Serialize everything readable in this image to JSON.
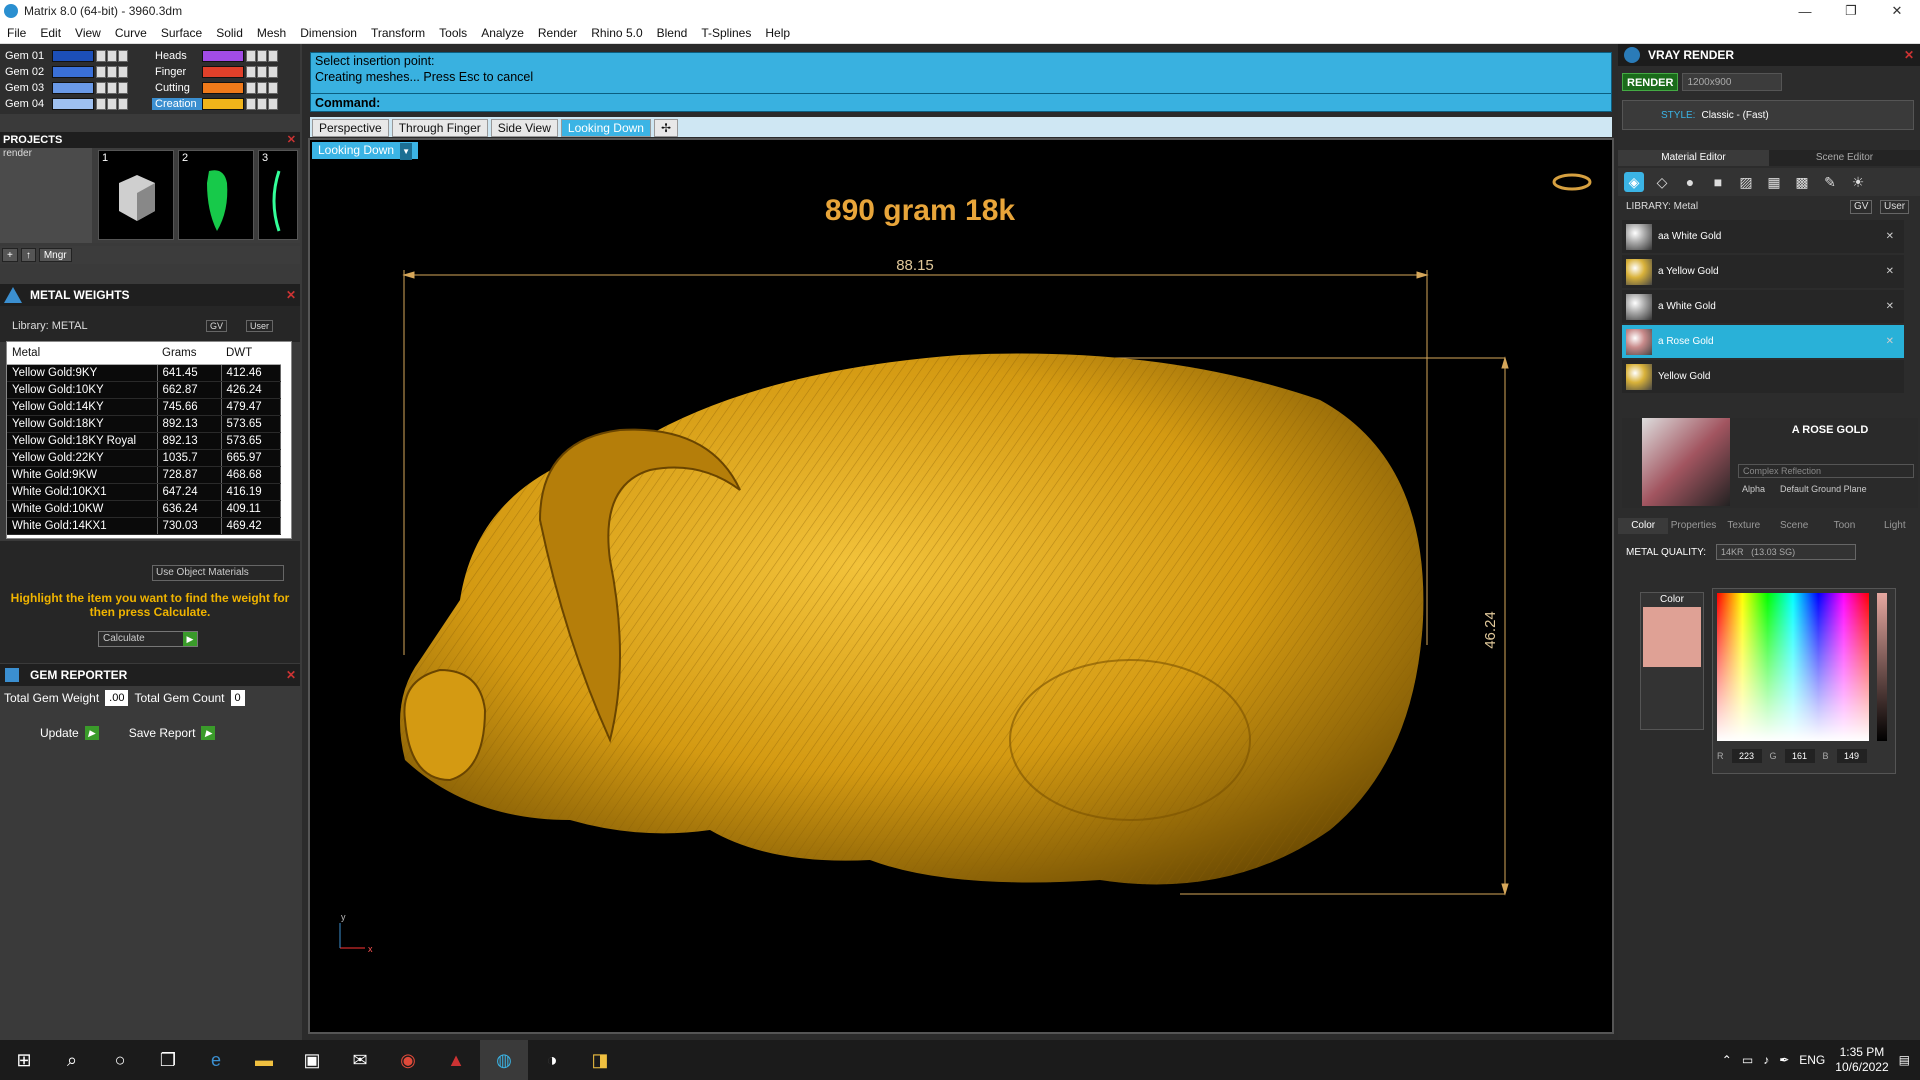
{
  "window": {
    "title": "Matrix 8.0 (64-bit) - 3960.3dm",
    "controls": [
      "—",
      "❐",
      "✕"
    ]
  },
  "menu": [
    "File",
    "Edit",
    "View",
    "Curve",
    "Surface",
    "Solid",
    "Mesh",
    "Dimension",
    "Transform",
    "Tools",
    "Analyze",
    "Render",
    "Rhino 5.0",
    "Blend",
    "T-Splines",
    "Help"
  ],
  "layers": {
    "left": [
      {
        "name": "Gem 01",
        "color": "#1c4fb8"
      },
      {
        "name": "Gem 02",
        "color": "#3a70d8"
      },
      {
        "name": "Gem 03",
        "color": "#6a9ae8"
      },
      {
        "name": "Gem 04",
        "color": "#9ec0f0"
      }
    ],
    "right": [
      {
        "name": "Heads",
        "color": "#a24ce6"
      },
      {
        "name": "Finger",
        "color": "#e0402a"
      },
      {
        "name": "Cutting",
        "color": "#f07a1a"
      },
      {
        "name": "Creation",
        "color": "#f0b41a"
      }
    ]
  },
  "projects": {
    "title": "PROJECTS",
    "list_item": "render",
    "thumb_numbers": [
      "1",
      "2",
      "3"
    ],
    "toolbar": [
      "+",
      "↑",
      "Mngr"
    ]
  },
  "metal_weights": {
    "title": "METAL WEIGHTS",
    "library": "Library: METAL",
    "gv": "GV",
    "user": "User",
    "columns": [
      "Metal",
      "Grams",
      "DWT"
    ],
    "rows": [
      [
        "Yellow Gold:9KY",
        "641.45",
        "412.46"
      ],
      [
        "Yellow Gold:10KY",
        "662.87",
        "426.24"
      ],
      [
        "Yellow Gold:14KY",
        "745.66",
        "479.47"
      ],
      [
        "Yellow Gold:18KY",
        "892.13",
        "573.65"
      ],
      [
        "Yellow Gold:18KY Royal",
        "892.13",
        "573.65"
      ],
      [
        "Yellow Gold:22KY",
        "1035.7",
        "665.97"
      ],
      [
        "White Gold:9KW",
        "728.87",
        "468.68"
      ],
      [
        "White Gold:10KX1",
        "647.24",
        "416.19"
      ],
      [
        "White Gold:10KW",
        "636.24",
        "409.11"
      ],
      [
        "White Gold:14KX1",
        "730.03",
        "469.42"
      ]
    ],
    "use_object": "Use Object Materials",
    "hint": "Highlight the item you want to find the weight for then press Calculate.",
    "calculate": "Calculate"
  },
  "gem_reporter": {
    "title": "GEM REPORTER",
    "total_weight_label": "Total Gem Weight",
    "total_weight": ".00",
    "total_count_label": "Total Gem Count",
    "total_count": "0",
    "update": "Update",
    "save_report": "Save Report"
  },
  "command": {
    "line1": "Select insertion point:",
    "line2": "Creating meshes... Press Esc to cancel",
    "prompt": "Command:"
  },
  "view_tabs": [
    "Perspective",
    "Through Finger",
    "Side View",
    "Looking Down"
  ],
  "active_view": "Looking Down",
  "viewport": {
    "label": "Looking Down",
    "annotation": "890 gram 18k",
    "dim_width": "88.15",
    "dim_height": "46.24",
    "axis_y": "y",
    "axis_x": "x"
  },
  "vray": {
    "title": "VRAY RENDER",
    "render": "RENDER",
    "resolution": "1200x900",
    "style_label": "STYLE:",
    "style_value": "Classic - (Fast)",
    "tabs": [
      "Material Editor",
      "Scene Editor"
    ],
    "library": "LIBRARY: Metal",
    "gv": "GV",
    "user": "User",
    "materials": [
      "aa White Gold",
      "a Yellow Gold",
      "a White Gold",
      "a Rose Gold",
      "Yellow Gold"
    ],
    "selected_material": "a Rose Gold",
    "preview_name": "A ROSE GOLD",
    "reflection": "Complex Reflection",
    "alpha": "Alpha",
    "ground": "Default Ground Plane",
    "prop_tabs": [
      "Color",
      "Properties",
      "Texture",
      "Scene",
      "Toon",
      "Light"
    ],
    "metal_quality_label": "METAL QUALITY:",
    "metal_quality": "14KR",
    "metal_quality_sg": "(13.03 SG)",
    "color_label": "Color",
    "swatch": "#dfa195",
    "r": "223",
    "g": "161",
    "b": "149"
  },
  "taskbar": {
    "lang": "ENG",
    "time": "1:35 PM",
    "date": "10/6/2022"
  },
  "colors": {
    "accent": "#3bb4e5",
    "gold": "#d9a11a",
    "warn_text": "#f0b400"
  }
}
